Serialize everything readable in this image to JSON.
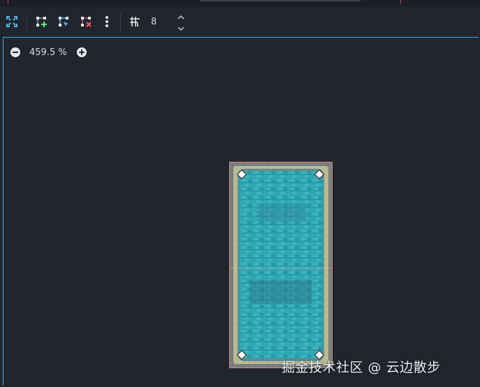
{
  "toolbar": {
    "snap_step": "8",
    "icons": [
      "fit-view-icon",
      "add-point-icon",
      "edit-points-icon",
      "remove-point-icon",
      "more-options-icon",
      "grid-snap-icon"
    ]
  },
  "viewport": {
    "zoom_label": "459.5 %"
  },
  "watermark": {
    "text": "掘金技术社区 @ 云边散步"
  },
  "colors": {
    "background": "#21252e",
    "accent": "#4aa8e6",
    "region": "#2fa6b5",
    "outline": "#d8d4a0"
  }
}
